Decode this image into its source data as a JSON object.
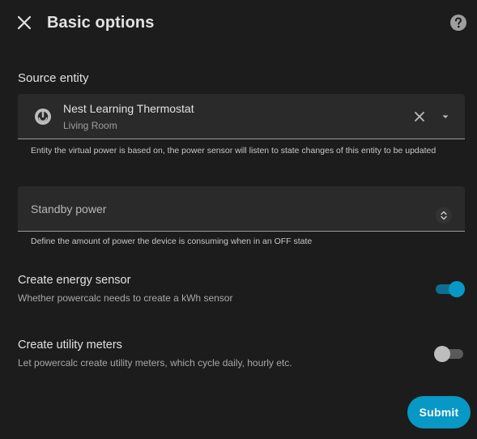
{
  "dialog": {
    "title": "Basic options"
  },
  "source_entity": {
    "label": "Source entity",
    "selected_name": "Nest Learning Thermostat",
    "selected_area": "Living Room",
    "helper": "Entity the virtual power is based on, the power sensor will listen to state changes of this entity to be updated"
  },
  "standby_power": {
    "label": "Standby power",
    "value": "",
    "helper": "Define the amount of power the device is consuming when in an OFF state"
  },
  "create_energy_sensor": {
    "title": "Create energy sensor",
    "description": "Whether powercalc needs to create a kWh sensor",
    "enabled": true
  },
  "create_utility_meters": {
    "title": "Create utility meters",
    "description": "Let powercalc create utility meters, which cycle daily, hourly etc.",
    "enabled": false
  },
  "actions": {
    "submit_label": "Submit"
  },
  "colors": {
    "accent": "#0798c6",
    "toggle_on_track": "#0b6f91",
    "toggle_off_track": "#5a5a5a",
    "toggle_off_thumb": "#bdbdbd",
    "background": "#1c1c1c",
    "field_background": "#2a2a2a"
  },
  "icons": {
    "close": "close-icon",
    "help": "help-circle-icon",
    "entity": "thermostat-icon",
    "clear": "clear-icon",
    "dropdown": "menu-down-icon",
    "spinner": "stepper-icon"
  }
}
